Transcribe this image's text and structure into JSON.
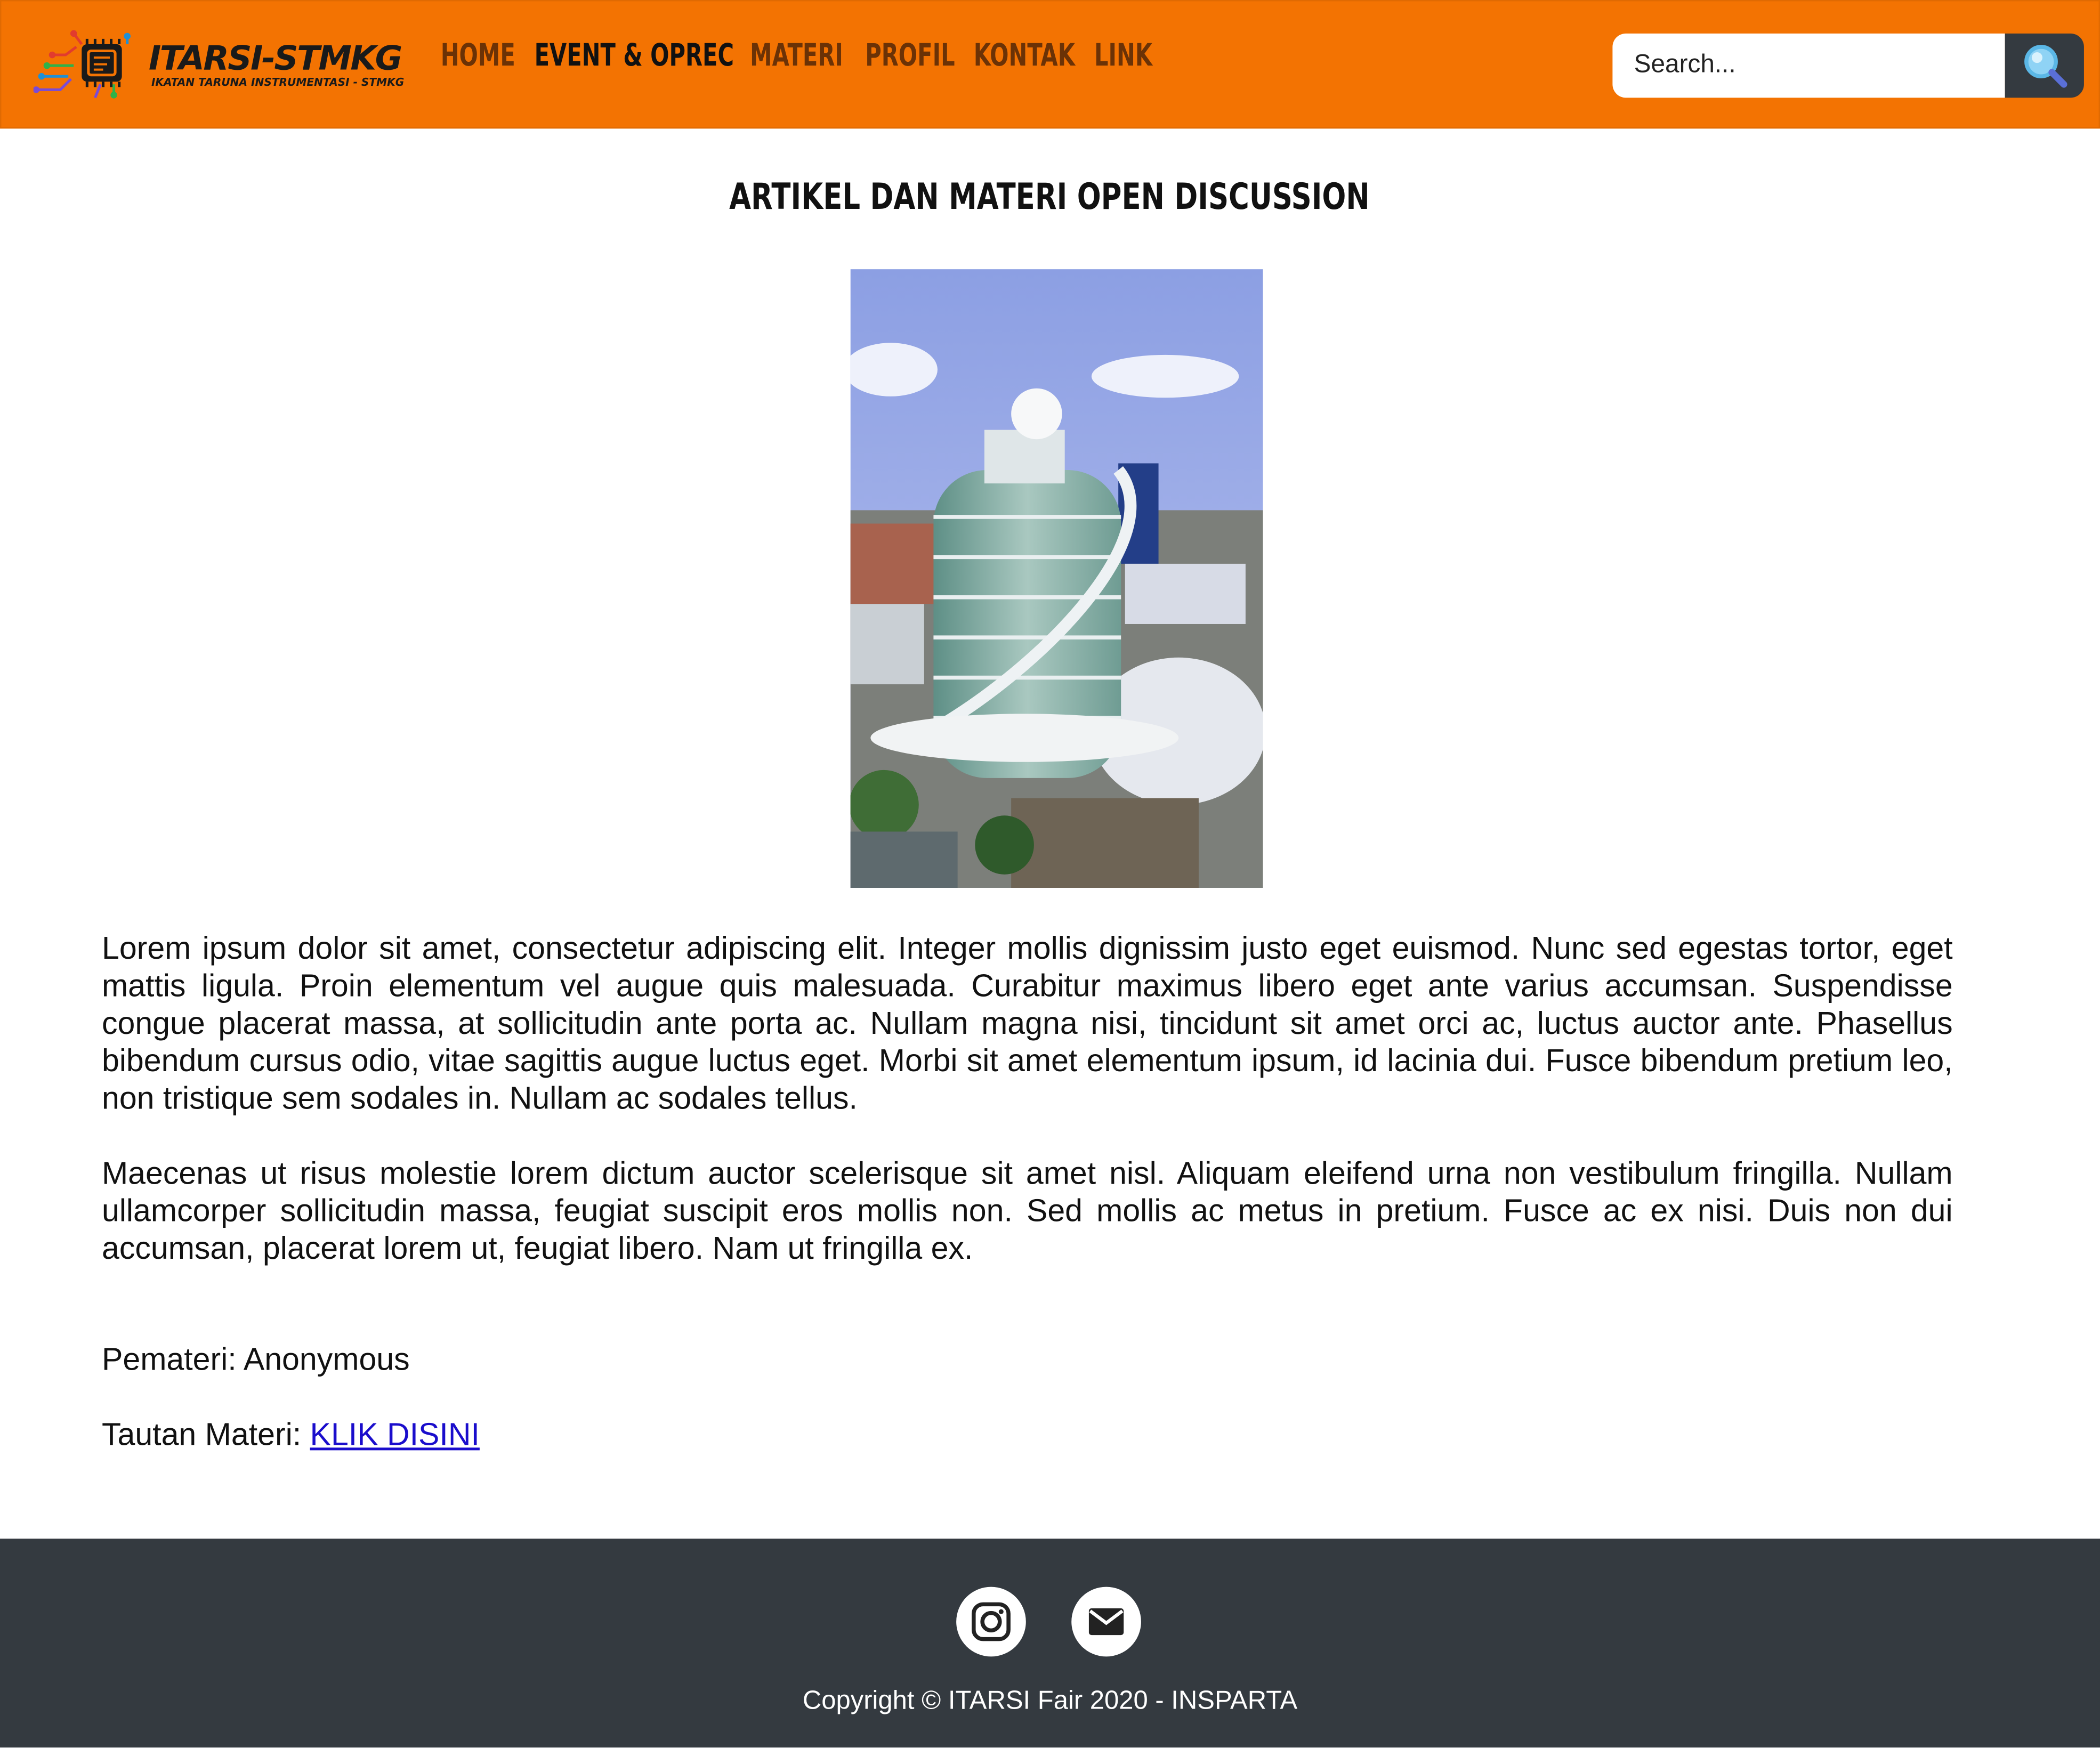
{
  "header": {
    "logo_title": "ITARSI-STMKG",
    "logo_subtitle": "IKATAN TARUNA INSTRUMENTASI - STMKG",
    "nav": [
      {
        "label": "HOME"
      },
      {
        "label": "EVENT & OPREC",
        "active": true
      },
      {
        "label": "MATERI"
      },
      {
        "label": "PROFIL"
      },
      {
        "label": "KONTAK"
      },
      {
        "label": "LINK"
      }
    ],
    "search_placeholder": "Search...",
    "accent_color": "#f37302"
  },
  "article": {
    "title": "ARTIKEL DAN MATERI OPEN DISCUSSION",
    "paragraphs": [
      "Lorem ipsum dolor sit amet, consectetur adipiscing elit. Integer mollis dignissim justo eget euismod. Nunc sed egestas tortor, eget mattis ligula. Proin elementum vel augue quis malesuada. Curabitur maximus libero eget ante varius accumsan. Suspendisse congue placerat massa, at sollicitudin ante porta ac. Nullam magna nisi, tincidunt sit amet orci ac, luctus auctor ante. Phasellus bibendum cursus odio, vitae sagittis augue luctus eget. Morbi sit amet elementum ipsum, id lacinia dui. Fusce bibendum pretium leo, non tristique sem sodales in. Nullam ac sodales tellus.",
      "Maecenas ut risus molestie lorem dictum auctor scelerisque sit amet nisl. Aliquam eleifend urna non vestibulum fringilla. Nullam ullamcorper sollicitudin massa, feugiat suscipit eros mollis non. Sed mollis ac metus in pretium. Fusce ac ex nisi. Duis non dui accumsan, placerat lorem ut, feugiat libero. Nam ut fringilla ex."
    ],
    "pemateri_label": "Pemateri: ",
    "pemateri_value": "Anonymous",
    "tautan_label": "Tautan Materi: ",
    "tautan_link": "KLIK DISINI"
  },
  "footer": {
    "icons": [
      "instagram-icon",
      "email-icon"
    ],
    "copyright": "Copyright © ITARSI Fair 2020 - INSPARTA",
    "background_color": "#343a40"
  }
}
